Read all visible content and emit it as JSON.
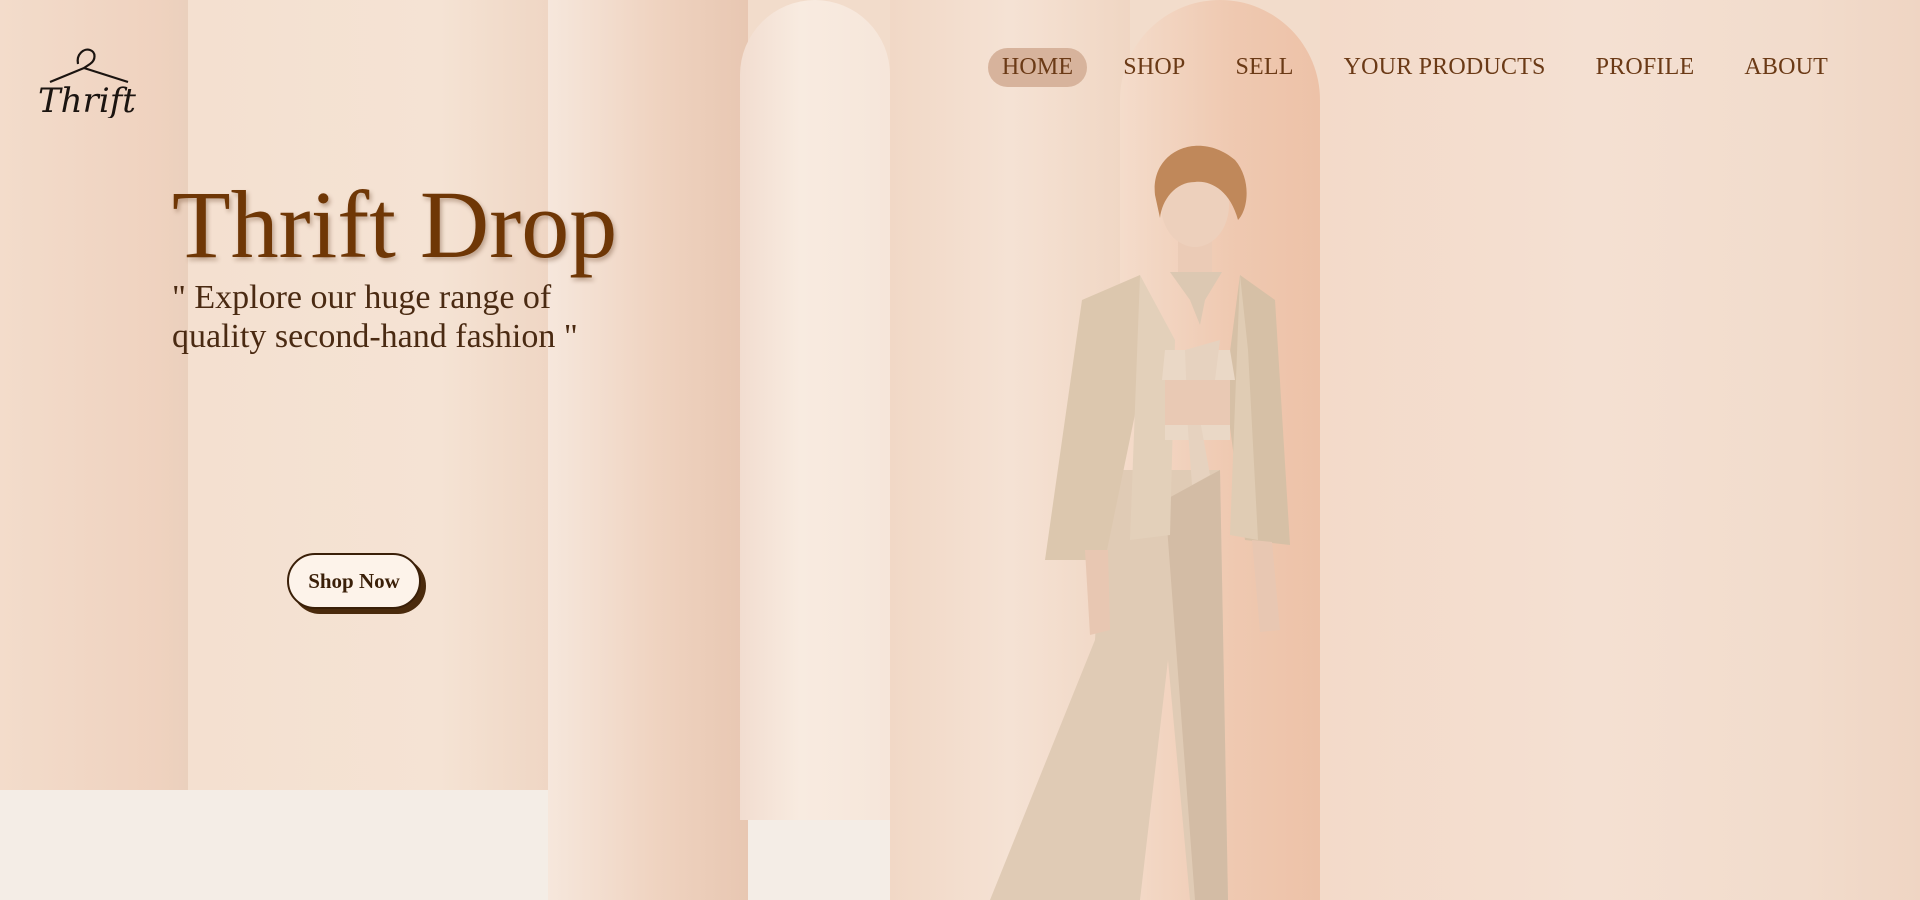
{
  "brand": {
    "logo_text": "Thrift",
    "logo_icon": "hanger-icon"
  },
  "nav": {
    "items": [
      {
        "label": "HOME",
        "active": true
      },
      {
        "label": "SHOP",
        "active": false
      },
      {
        "label": "SELL",
        "active": false
      },
      {
        "label": "YOUR PRODUCTS",
        "active": false
      },
      {
        "label": "PROFILE",
        "active": false
      },
      {
        "label": "ABOUT",
        "active": false
      }
    ]
  },
  "hero": {
    "title": "Thrift Drop",
    "subtitle": "\" Explore our huge range of quality second-hand fashion \"",
    "cta_label": "Shop Now"
  },
  "colors": {
    "accent": "#6f3706",
    "nav_text": "#6b3a16",
    "active_pill": "#d7b39c",
    "background": "#f2dccb"
  }
}
